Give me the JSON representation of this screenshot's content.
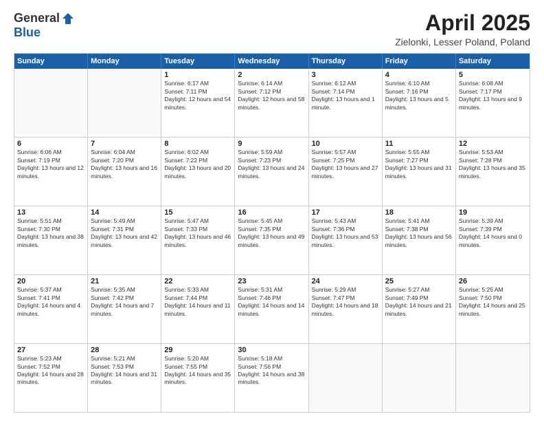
{
  "header": {
    "logo_general": "General",
    "logo_blue": "Blue",
    "month_title": "April 2025",
    "location": "Zielonki, Lesser Poland, Poland"
  },
  "days_of_week": [
    "Sunday",
    "Monday",
    "Tuesday",
    "Wednesday",
    "Thursday",
    "Friday",
    "Saturday"
  ],
  "weeks": [
    [
      {
        "day": "",
        "empty": true
      },
      {
        "day": "",
        "empty": true
      },
      {
        "day": "1",
        "sunrise": "Sunrise: 6:17 AM",
        "sunset": "Sunset: 7:11 PM",
        "daylight": "Daylight: 12 hours and 54 minutes."
      },
      {
        "day": "2",
        "sunrise": "Sunrise: 6:14 AM",
        "sunset": "Sunset: 7:12 PM",
        "daylight": "Daylight: 12 hours and 58 minutes."
      },
      {
        "day": "3",
        "sunrise": "Sunrise: 6:12 AM",
        "sunset": "Sunset: 7:14 PM",
        "daylight": "Daylight: 13 hours and 1 minute."
      },
      {
        "day": "4",
        "sunrise": "Sunrise: 6:10 AM",
        "sunset": "Sunset: 7:16 PM",
        "daylight": "Daylight: 13 hours and 5 minutes."
      },
      {
        "day": "5",
        "sunrise": "Sunrise: 6:08 AM",
        "sunset": "Sunset: 7:17 PM",
        "daylight": "Daylight: 13 hours and 9 minutes."
      }
    ],
    [
      {
        "day": "6",
        "sunrise": "Sunrise: 6:06 AM",
        "sunset": "Sunset: 7:19 PM",
        "daylight": "Daylight: 13 hours and 12 minutes."
      },
      {
        "day": "7",
        "sunrise": "Sunrise: 6:04 AM",
        "sunset": "Sunset: 7:20 PM",
        "daylight": "Daylight: 13 hours and 16 minutes."
      },
      {
        "day": "8",
        "sunrise": "Sunrise: 6:02 AM",
        "sunset": "Sunset: 7:22 PM",
        "daylight": "Daylight: 13 hours and 20 minutes."
      },
      {
        "day": "9",
        "sunrise": "Sunrise: 5:59 AM",
        "sunset": "Sunset: 7:23 PM",
        "daylight": "Daylight: 13 hours and 24 minutes."
      },
      {
        "day": "10",
        "sunrise": "Sunrise: 5:57 AM",
        "sunset": "Sunset: 7:25 PM",
        "daylight": "Daylight: 13 hours and 27 minutes."
      },
      {
        "day": "11",
        "sunrise": "Sunrise: 5:55 AM",
        "sunset": "Sunset: 7:27 PM",
        "daylight": "Daylight: 13 hours and 31 minutes."
      },
      {
        "day": "12",
        "sunrise": "Sunrise: 5:53 AM",
        "sunset": "Sunset: 7:28 PM",
        "daylight": "Daylight: 13 hours and 35 minutes."
      }
    ],
    [
      {
        "day": "13",
        "sunrise": "Sunrise: 5:51 AM",
        "sunset": "Sunset: 7:30 PM",
        "daylight": "Daylight: 13 hours and 38 minutes."
      },
      {
        "day": "14",
        "sunrise": "Sunrise: 5:49 AM",
        "sunset": "Sunset: 7:31 PM",
        "daylight": "Daylight: 13 hours and 42 minutes."
      },
      {
        "day": "15",
        "sunrise": "Sunrise: 5:47 AM",
        "sunset": "Sunset: 7:33 PM",
        "daylight": "Daylight: 13 hours and 46 minutes."
      },
      {
        "day": "16",
        "sunrise": "Sunrise: 5:45 AM",
        "sunset": "Sunset: 7:35 PM",
        "daylight": "Daylight: 13 hours and 49 minutes."
      },
      {
        "day": "17",
        "sunrise": "Sunrise: 5:43 AM",
        "sunset": "Sunset: 7:36 PM",
        "daylight": "Daylight: 13 hours and 53 minutes."
      },
      {
        "day": "18",
        "sunrise": "Sunrise: 5:41 AM",
        "sunset": "Sunset: 7:38 PM",
        "daylight": "Daylight: 13 hours and 56 minutes."
      },
      {
        "day": "19",
        "sunrise": "Sunrise: 5:39 AM",
        "sunset": "Sunset: 7:39 PM",
        "daylight": "Daylight: 14 hours and 0 minutes."
      }
    ],
    [
      {
        "day": "20",
        "sunrise": "Sunrise: 5:37 AM",
        "sunset": "Sunset: 7:41 PM",
        "daylight": "Daylight: 14 hours and 4 minutes."
      },
      {
        "day": "21",
        "sunrise": "Sunrise: 5:35 AM",
        "sunset": "Sunset: 7:42 PM",
        "daylight": "Daylight: 14 hours and 7 minutes."
      },
      {
        "day": "22",
        "sunrise": "Sunrise: 5:33 AM",
        "sunset": "Sunset: 7:44 PM",
        "daylight": "Daylight: 14 hours and 11 minutes."
      },
      {
        "day": "23",
        "sunrise": "Sunrise: 5:31 AM",
        "sunset": "Sunset: 7:46 PM",
        "daylight": "Daylight: 14 hours and 14 minutes."
      },
      {
        "day": "24",
        "sunrise": "Sunrise: 5:29 AM",
        "sunset": "Sunset: 7:47 PM",
        "daylight": "Daylight: 14 hours and 18 minutes."
      },
      {
        "day": "25",
        "sunrise": "Sunrise: 5:27 AM",
        "sunset": "Sunset: 7:49 PM",
        "daylight": "Daylight: 14 hours and 21 minutes."
      },
      {
        "day": "26",
        "sunrise": "Sunrise: 5:25 AM",
        "sunset": "Sunset: 7:50 PM",
        "daylight": "Daylight: 14 hours and 25 minutes."
      }
    ],
    [
      {
        "day": "27",
        "sunrise": "Sunrise: 5:23 AM",
        "sunset": "Sunset: 7:52 PM",
        "daylight": "Daylight: 14 hours and 28 minutes."
      },
      {
        "day": "28",
        "sunrise": "Sunrise: 5:21 AM",
        "sunset": "Sunset: 7:53 PM",
        "daylight": "Daylight: 14 hours and 31 minutes."
      },
      {
        "day": "29",
        "sunrise": "Sunrise: 5:20 AM",
        "sunset": "Sunset: 7:55 PM",
        "daylight": "Daylight: 14 hours and 35 minutes."
      },
      {
        "day": "30",
        "sunrise": "Sunrise: 5:18 AM",
        "sunset": "Sunset: 7:56 PM",
        "daylight": "Daylight: 14 hours and 38 minutes."
      },
      {
        "day": "",
        "empty": true
      },
      {
        "day": "",
        "empty": true
      },
      {
        "day": "",
        "empty": true
      }
    ]
  ]
}
